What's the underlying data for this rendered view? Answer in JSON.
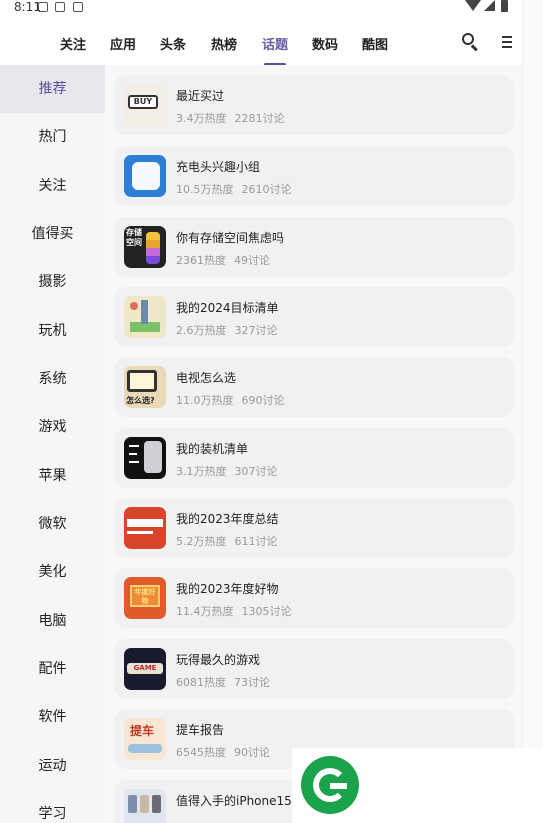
{
  "status_bar": {
    "time": "8:11"
  },
  "top_tabs": [
    {
      "label": "关注"
    },
    {
      "label": "应用"
    },
    {
      "label": "头条"
    },
    {
      "label": "热榜"
    },
    {
      "label": "话题"
    },
    {
      "label": "数码"
    },
    {
      "label": "酷图"
    }
  ],
  "active_tab": "话题",
  "sidebar": {
    "items": [
      {
        "label": "推荐"
      },
      {
        "label": "热门"
      },
      {
        "label": "关注"
      },
      {
        "label": "值得买"
      },
      {
        "label": "摄影"
      },
      {
        "label": "玩机"
      },
      {
        "label": "系统"
      },
      {
        "label": "游戏"
      },
      {
        "label": "苹果"
      },
      {
        "label": "微软"
      },
      {
        "label": "美化"
      },
      {
        "label": "电脑"
      },
      {
        "label": "配件"
      },
      {
        "label": "软件"
      },
      {
        "label": "运动"
      },
      {
        "label": "学习"
      }
    ],
    "active": "推荐"
  },
  "topics": [
    {
      "title": "最近买过",
      "heat": "3.4万热度",
      "discussions": "2281讨论",
      "thumb_color": "#f4efe6",
      "thumb_text": "BUY"
    },
    {
      "title": "充电头兴趣小组",
      "heat": "10.5万热度",
      "discussions": "2610讨论",
      "thumb_color": "#2b7fd6",
      "thumb_text": ""
    },
    {
      "title": "你有存储空间焦虑吗",
      "heat": "2361热度",
      "discussions": "49讨论",
      "thumb_color": "#222222",
      "thumb_text": "存储空间"
    },
    {
      "title": "我的2024目标清单",
      "heat": "2.6万热度",
      "discussions": "327讨论",
      "thumb_color": "#f0e6c8",
      "thumb_text": ""
    },
    {
      "title": "电视怎么选",
      "heat": "11.0万热度",
      "discussions": "690讨论",
      "thumb_color": "#e9d9b8",
      "thumb_text": "怎么选?"
    },
    {
      "title": "我的装机清单",
      "heat": "3.1万热度",
      "discussions": "307讨论",
      "thumb_color": "#111111",
      "thumb_text": ""
    },
    {
      "title": "我的2023年度总结",
      "heat": "5.2万热度",
      "discussions": "611讨论",
      "thumb_color": "#d9452b",
      "thumb_text": ""
    },
    {
      "title": "我的2023年度好物",
      "heat": "11.4万热度",
      "discussions": "1305讨论",
      "thumb_color": "#e05a2a",
      "thumb_text": "年度好物"
    },
    {
      "title": "玩得最久的游戏",
      "heat": "6081热度",
      "discussions": "73讨论",
      "thumb_color": "#1a1a2e",
      "thumb_text": "GAME"
    },
    {
      "title": "提车报告",
      "heat": "6545热度",
      "discussions": "90讨论",
      "thumb_color": "#f7e7d2",
      "thumb_text": "提车"
    },
    {
      "title": "值得入手的iPhone15",
      "heat": "",
      "discussions": "",
      "thumb_color": "#dfe6f0",
      "thumb_text": ""
    }
  ],
  "colors": {
    "accent": "#5b4f9a",
    "logo_green": "#1aa34a"
  }
}
